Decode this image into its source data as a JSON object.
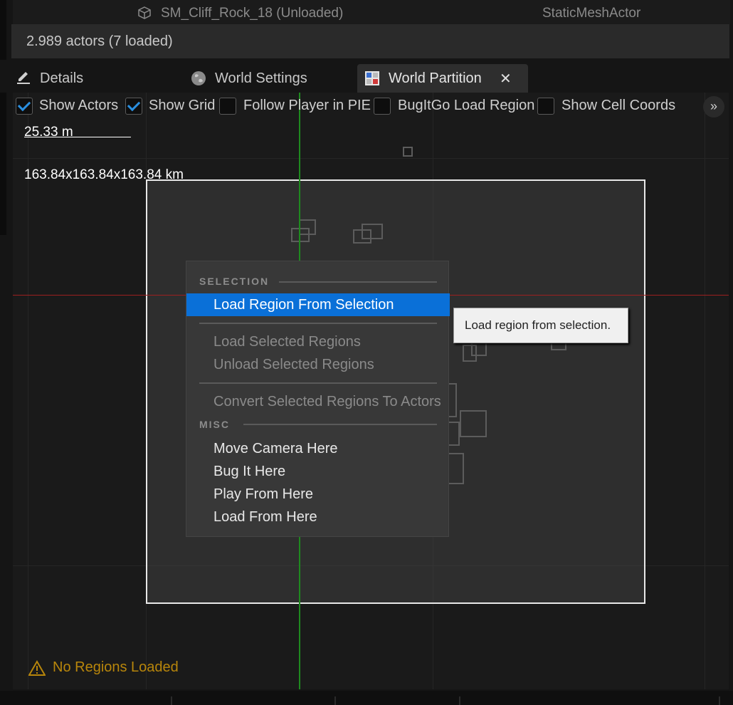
{
  "outliner": {
    "row_name": "SM_Cliff_Rock_18 (Unloaded)",
    "row_type": "StaticMeshActor",
    "actors_summary": "2.989 actors (7 loaded)"
  },
  "tabs": [
    {
      "label": "Details",
      "icon": "pencil-icon"
    },
    {
      "label": "World Settings",
      "icon": "globe-icon"
    },
    {
      "label": "World Partition",
      "icon": "grid-icon",
      "active": true
    }
  ],
  "toolbar": {
    "options": [
      {
        "label": "Show Actors",
        "checked": true
      },
      {
        "label": "Show Grid",
        "checked": true
      },
      {
        "label": "Follow Player in PIE",
        "checked": false
      },
      {
        "label": "BugItGo Load Region",
        "checked": false
      },
      {
        "label": "Show Cell Coords",
        "checked": false
      }
    ],
    "more_glyph": "»"
  },
  "viewport": {
    "scale_text": "25.33 m",
    "world_size_text": "163.84x163.84x163.84 km"
  },
  "context_menu": {
    "section_selection": "SELECTION",
    "load_region_from_selection": "Load Region From Selection",
    "load_selected_regions": "Load Selected Regions",
    "unload_selected_regions": "Unload Selected Regions",
    "convert_selected_regions": "Convert Selected Regions To Actors",
    "section_misc": "MISC",
    "move_camera_here": "Move Camera Here",
    "bug_it_here": "Bug It Here",
    "play_from_here": "Play From Here",
    "load_from_here": "Load From Here"
  },
  "tooltip": "Load region from selection.",
  "status": "No Regions Loaded",
  "colors": {
    "accent": "#0a70d8",
    "x_axis": "#9c2020",
    "y_axis": "#1f8a1f",
    "warning": "#b8860b"
  }
}
